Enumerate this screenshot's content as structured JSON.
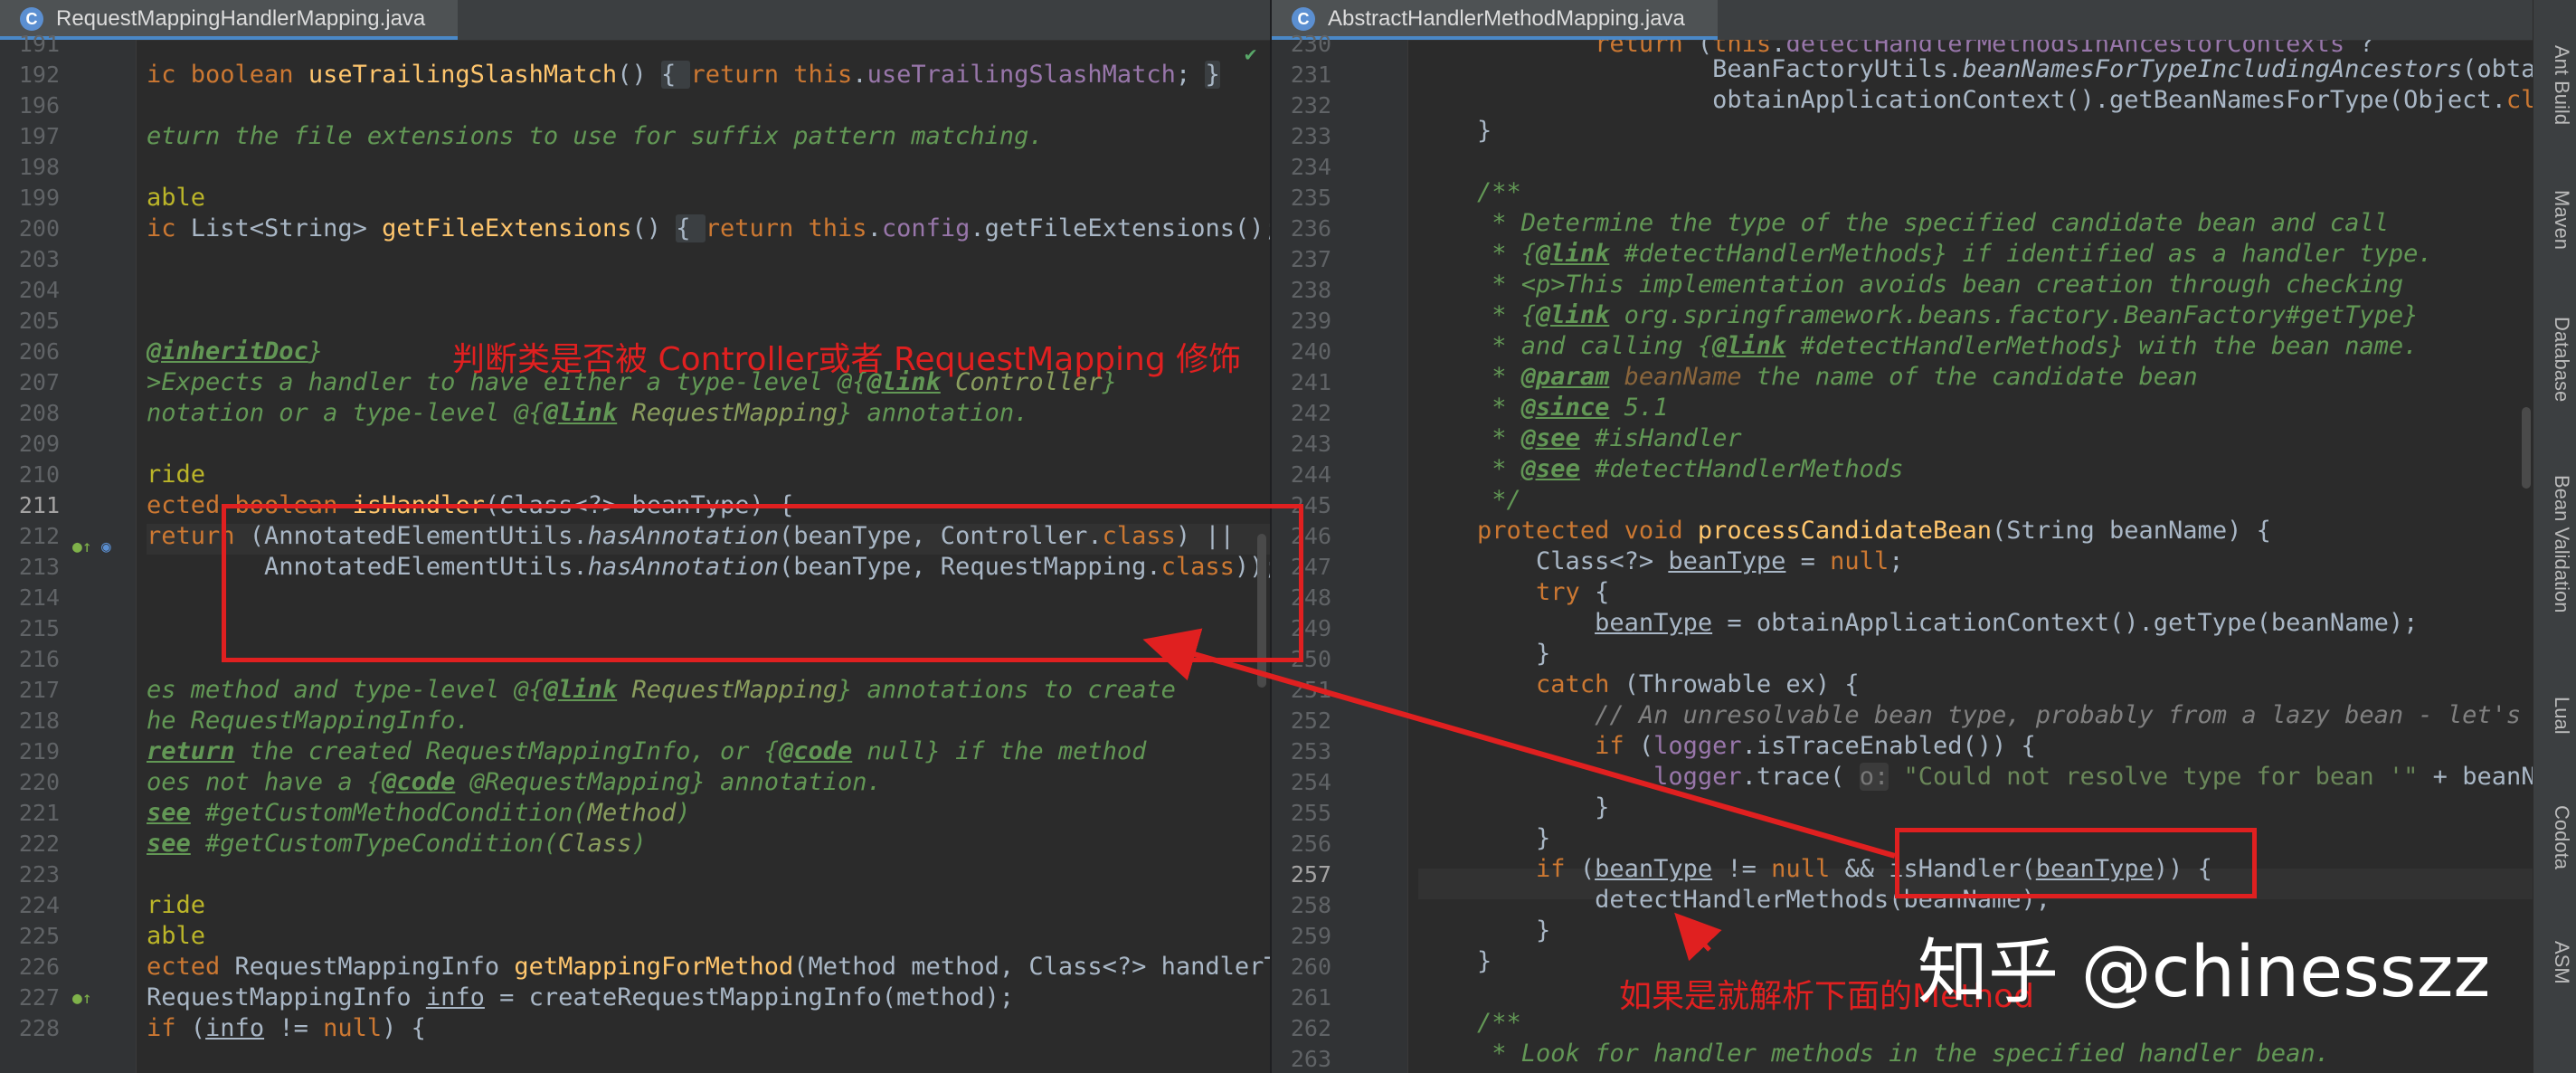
{
  "left_tab": {
    "label": "RequestMappingHandlerMapping.java"
  },
  "right_tab": {
    "label": "AbstractHandlerMethodMapping.java"
  },
  "left_line_numbers": [
    "191",
    "192",
    "196",
    "197",
    "198",
    "199",
    "200",
    "203",
    "204",
    "205",
    "206",
    "207",
    "208",
    "209",
    "210",
    "211",
    "212",
    "213",
    "214",
    "215",
    "216",
    "217",
    "218",
    "219",
    "220",
    "221",
    "222",
    "223",
    "224",
    "225",
    "226",
    "227",
    "228"
  ],
  "right_line_numbers": [
    "230",
    "231",
    "232",
    "233",
    "234",
    "235",
    "236",
    "237",
    "238",
    "239",
    "240",
    "241",
    "242",
    "243",
    "244",
    "245",
    "246",
    "247",
    "248",
    "249",
    "250",
    "251",
    "252",
    "253",
    "254",
    "255",
    "256",
    "257",
    "258",
    "259",
    "260",
    "261",
    "262",
    "263"
  ],
  "tool_windows": [
    "Ant Build",
    "Maven",
    "Database",
    "Bean Validation",
    "Lual",
    "Codota",
    "ASM"
  ],
  "annotations": {
    "top_note": "判断类是否被 Controller或者 RequestMapping 修饰",
    "bottom_note": "如果是就解析下面的Method",
    "watermark": "知乎 @chinesszz"
  },
  "colors": {
    "annotation_red": "#e02020",
    "keyword": "#cc7832",
    "method": "#ffc66d",
    "comment": "#629755",
    "field": "#9876aa"
  }
}
